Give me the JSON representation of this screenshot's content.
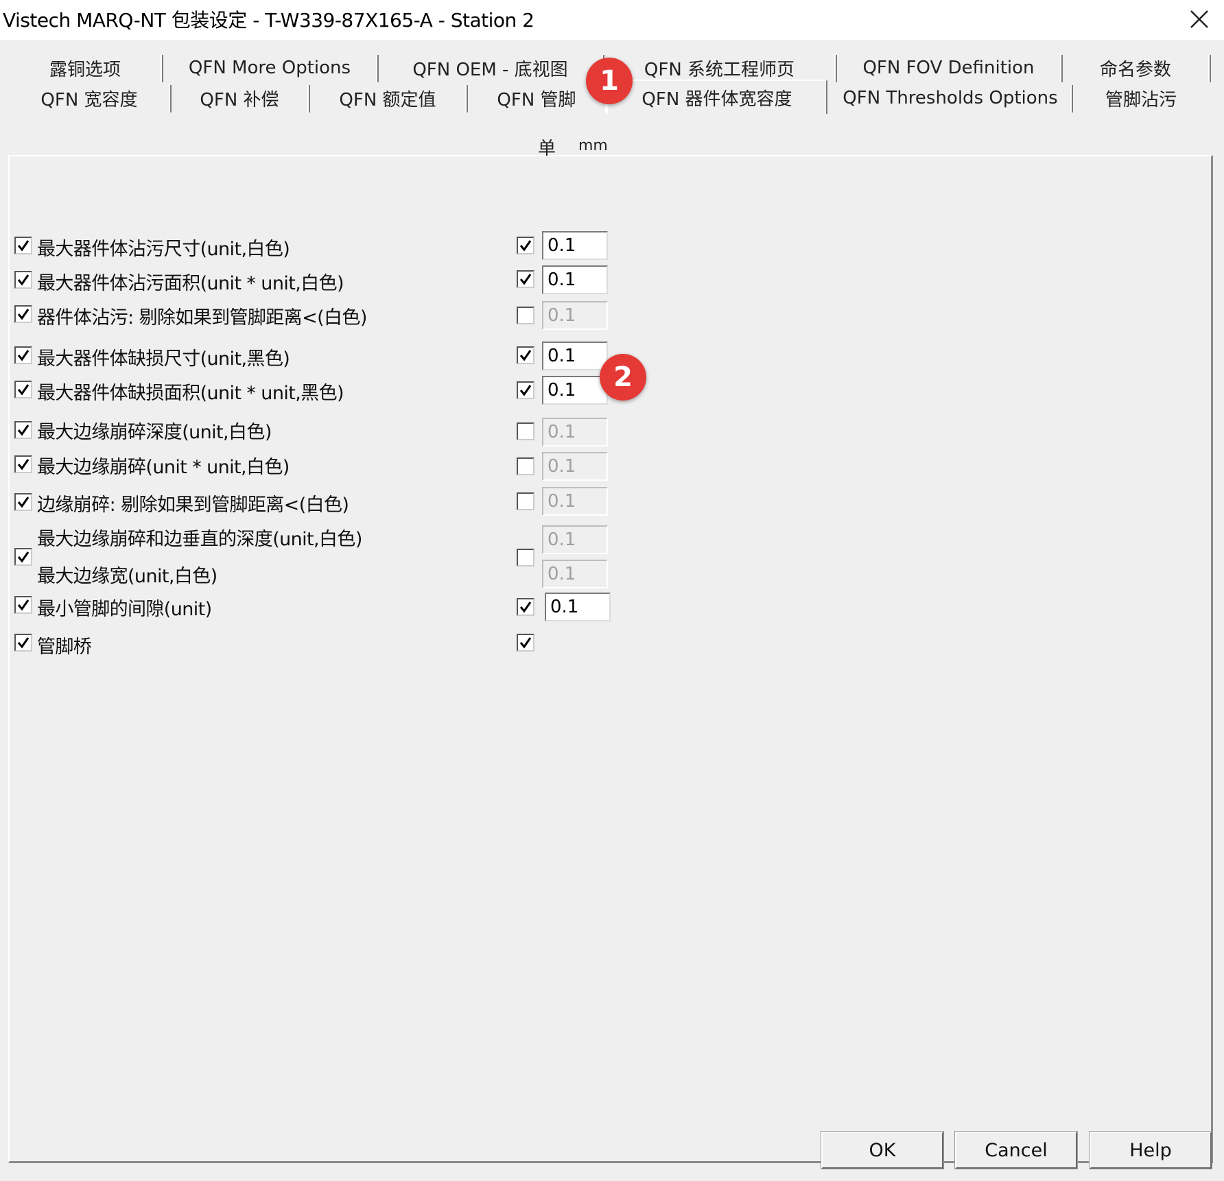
{
  "window": {
    "title": "Vistech MARQ-NT 包装设定  - T-W339-87X165-A - Station 2"
  },
  "tabs_row1": [
    {
      "label": "露铜选项"
    },
    {
      "label": "QFN More Options"
    },
    {
      "label": "QFN OEM - 底视图"
    },
    {
      "label": "QFN 系统工程师页"
    },
    {
      "label": "QFN FOV Definition"
    },
    {
      "label": "命名参数"
    }
  ],
  "tabs_row2": [
    {
      "label": "QFN 宽容度"
    },
    {
      "label": "QFN 补偿"
    },
    {
      "label": "QFN 额定值"
    },
    {
      "label": "QFN 管脚"
    },
    {
      "label": "QFN 器件体宽容度",
      "active": true
    },
    {
      "label": "QFN Thresholds Options"
    },
    {
      "label": "管脚沾污"
    }
  ],
  "badges": {
    "b1": "1",
    "b2": "2"
  },
  "units": {
    "label": "单",
    "value": "mm"
  },
  "rows": [
    {
      "label": "最大器件体沾污尺寸(unit,白色)",
      "enabled": true,
      "value_checked": true,
      "value": "0.1"
    },
    {
      "label": "最大器件体沾污面积(unit * unit,白色)",
      "enabled": true,
      "value_checked": true,
      "value": "0.1"
    },
    {
      "label": "器件体沾污: 剔除如果到管脚距离<(白色)",
      "enabled": true,
      "value_checked": false,
      "value": "0.1"
    },
    {
      "label": "最大器件体缺损尺寸(unit,黑色)",
      "enabled": true,
      "value_checked": true,
      "value": "0.1"
    },
    {
      "label": "最大器件体缺损面积(unit * unit,黑色)",
      "enabled": true,
      "value_checked": true,
      "value": "0.1"
    },
    {
      "label": "最大边缘崩碎深度(unit,白色)",
      "enabled": true,
      "value_checked": false,
      "value": "0.1"
    },
    {
      "label": "最大边缘崩碎(unit * unit,白色)",
      "enabled": true,
      "value_checked": false,
      "value": "0.1"
    },
    {
      "label": "边缘崩碎: 剔除如果到管脚距离<(白色)",
      "enabled": true,
      "value_checked": false,
      "value": "0.1"
    },
    {
      "label": "最大边缘崩碎和边垂直的深度(unit,白色)",
      "label2": "最大边缘宽(unit,白色)",
      "enabled": true,
      "value_checked": false,
      "value": "0.1",
      "value2": "0.1"
    },
    {
      "label": "最小管脚的间隙(unit)",
      "enabled": true,
      "value_checked": true,
      "value": "0.1"
    },
    {
      "label": "管脚桥",
      "enabled": true,
      "value_checked": true
    }
  ],
  "buttons": {
    "ok": "OK",
    "cancel": "Cancel",
    "help": "Help"
  }
}
